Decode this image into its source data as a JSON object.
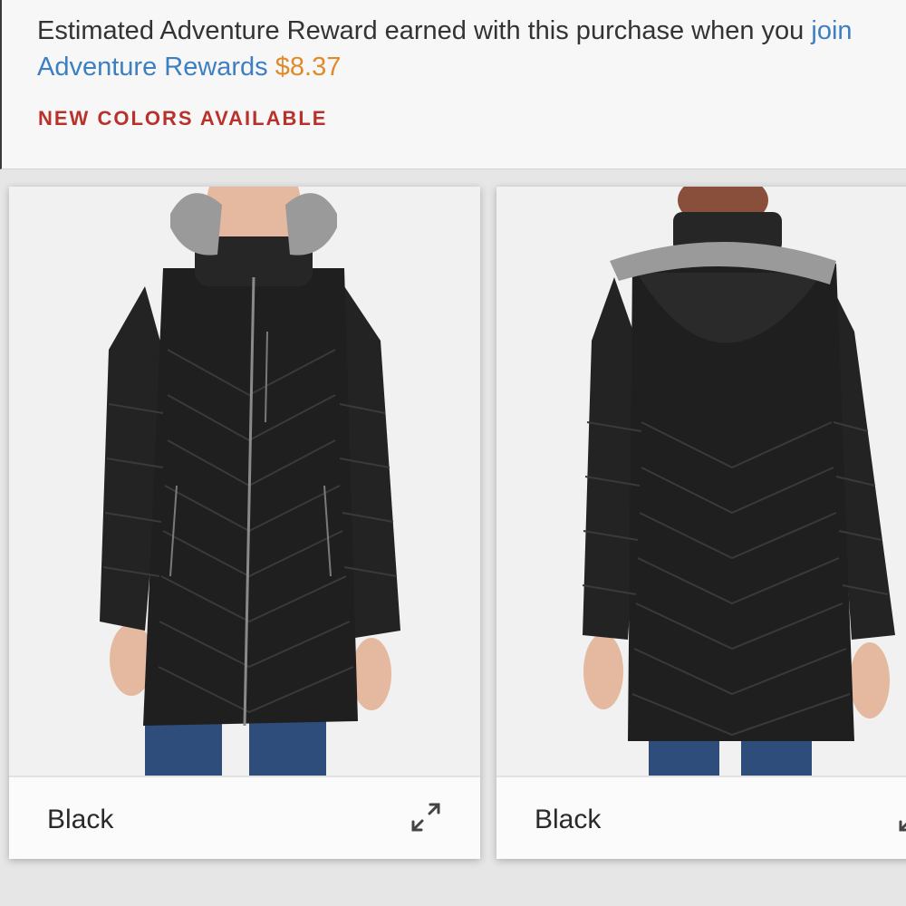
{
  "reward": {
    "text_before": "Estimated Adventure Reward earned with this purchase when you ",
    "link_text": "join Adventure Rewards",
    "amount": "$8.37"
  },
  "badge": {
    "new_colors": "NEW COLORS AVAILABLE"
  },
  "cards": [
    {
      "color_name": "Black",
      "view": "front",
      "icon": "expand-icon"
    },
    {
      "color_name": "Black",
      "view": "back",
      "icon": "expand-icon"
    }
  ],
  "colors": {
    "link": "#3d7fc1",
    "amount": "#e08a2a",
    "badge": "#b8322b",
    "jacket": "#1f1f1f",
    "fur": "#9a9a9a",
    "jeans": "#2e4d7a"
  }
}
